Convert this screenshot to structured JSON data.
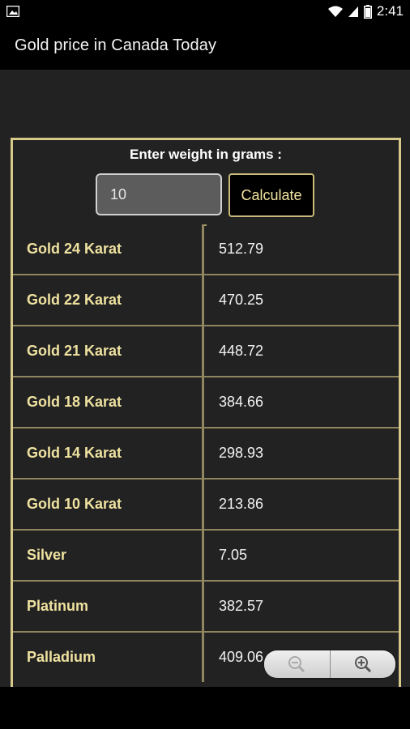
{
  "status_bar": {
    "time": "2:41"
  },
  "app_bar": {
    "title": "Gold price in Canada Today"
  },
  "calculator": {
    "label": "Enter weight in grams :",
    "weight_value": "10",
    "calculate_label": "Calculate"
  },
  "prices": [
    {
      "name": "Gold 24 Karat",
      "value": "512.79"
    },
    {
      "name": "Gold 22 Karat",
      "value": "470.25"
    },
    {
      "name": "Gold 21 Karat",
      "value": "448.72"
    },
    {
      "name": "Gold 18 Karat",
      "value": "384.66"
    },
    {
      "name": "Gold 14 Karat",
      "value": "298.93"
    },
    {
      "name": "Gold 10 Karat",
      "value": "213.86"
    },
    {
      "name": "Silver",
      "value": "7.05"
    },
    {
      "name": "Platinum",
      "value": "382.57"
    },
    {
      "name": "Palladium",
      "value": "409.06"
    }
  ],
  "zoom_controls": {
    "zoom_out_icon": "zoom-out-icon",
    "zoom_in_icon": "zoom-in-icon"
  },
  "colors": {
    "accent_gold": "#d6c98a",
    "label_gold": "#efe2a0",
    "background": "#222222"
  }
}
